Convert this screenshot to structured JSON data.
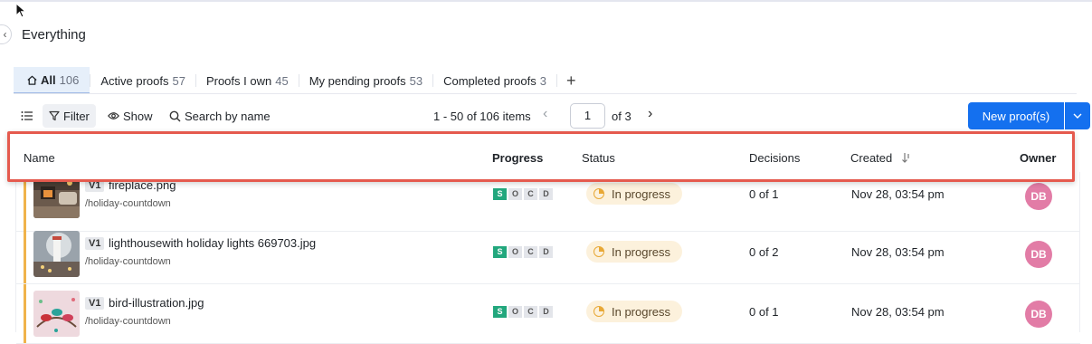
{
  "page": {
    "title": "Everything"
  },
  "tabs": [
    {
      "label": "All",
      "count": "106"
    },
    {
      "label": "Active proofs",
      "count": "57"
    },
    {
      "label": "Proofs I own",
      "count": "45"
    },
    {
      "label": "My pending proofs",
      "count": "53"
    },
    {
      "label": "Completed proofs",
      "count": "3"
    }
  ],
  "tabs_add": "+",
  "toolbar": {
    "filter_label": "Filter",
    "show_label": "Show",
    "search_placeholder": "Search by name",
    "pager_text": "1 - 50 of 106 items",
    "page_value": "1",
    "page_of": "of 3",
    "new_button_label": "New proof(s)"
  },
  "columns": {
    "name": "Name",
    "progress": "Progress",
    "status": "Status",
    "decisions": "Decisions",
    "created": "Created",
    "owner": "Owner"
  },
  "progress_letters": [
    "S",
    "O",
    "C",
    "D"
  ],
  "rows": [
    {
      "version": "V1",
      "file_name": "fireplace.png",
      "path": "/holiday-countdown",
      "status": "In progress",
      "decisions": "0 of 1",
      "created": "Nov 28, 03:54 pm",
      "owner_initials": "DB"
    },
    {
      "version": "V1",
      "file_name": "lighthousewith holiday lights 669703.jpg",
      "path": "/holiday-countdown",
      "status": "In progress",
      "decisions": "0 of 2",
      "created": "Nov 28, 03:54 pm",
      "owner_initials": "DB"
    },
    {
      "version": "V1",
      "file_name": "bird-illustration.jpg",
      "path": "/holiday-countdown",
      "status": "In progress",
      "decisions": "0 of 1",
      "created": "Nov 28, 03:54 pm",
      "owner_initials": "DB"
    }
  ],
  "colors": {
    "accent_blue": "#1470ef",
    "highlight_red": "#e55a4e",
    "status_bg": "#fcf1dc",
    "progress_green": "#22a77d",
    "avatar_pink": "#e27ca6"
  }
}
